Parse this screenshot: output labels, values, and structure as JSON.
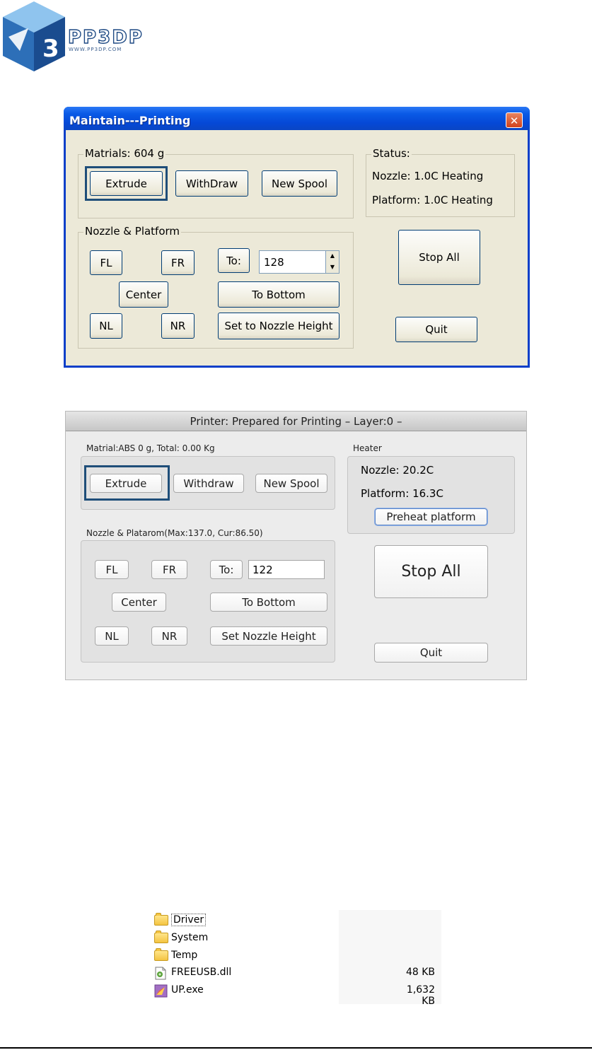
{
  "logo": {
    "text": "PP3DP",
    "url": "WWW.PP3DP.COM",
    "numeral": "3"
  },
  "xp_dialog": {
    "title": "Maintain---Printing",
    "close_symbol": "✕",
    "materials_label": "Matrials: 604 g",
    "extrude_label": "Extrude",
    "withdraw_label": "WithDraw",
    "new_spool_label": "New Spool",
    "status_label": "Status:",
    "nozzle_status": "Nozzle: 1.0C Heating",
    "platform_status": "Platform: 1.0C Heating",
    "nozzle_platform_label": "Nozzle & Platform",
    "fl_label": "FL",
    "fr_label": "FR",
    "to_label": "To:",
    "to_value": "128",
    "spin_up": "▲",
    "spin_down": "▼",
    "center_label": "Center",
    "to_bottom_label": "To Bottom",
    "nl_label": "NL",
    "nr_label": "NR",
    "set_nozzle_label": "Set to Nozzle Height",
    "stop_all_label": "Stop All",
    "quit_label": "Quit"
  },
  "mac_dialog": {
    "title": "Printer: Prepared for Printing – Layer:0 –",
    "material_label": "Matrial:ABS 0 g,  Total: 0.00 Kg",
    "extrude_label": "Extrude",
    "withdraw_label": "Withdraw",
    "new_spool_label": "New Spool",
    "heater_label": "Heater",
    "nozzle_temp": "Nozzle: 20.2C",
    "platform_temp": "Platform: 16.3C",
    "preheat_label": "Preheat platform",
    "nozzle_platform_label": "Nozzle & Platarom(Max:137.0, Cur:86.50)",
    "fl_label": "FL",
    "fr_label": "FR",
    "to_label": "To:",
    "to_value": "122",
    "center_label": "Center",
    "to_bottom_label": "To Bottom",
    "nl_label": "NL",
    "nr_label": "NR",
    "set_nozzle_label": "Set Nozzle  Height",
    "stop_all_label": "Stop All",
    "quit_label": "Quit"
  },
  "explorer": {
    "files": [
      {
        "name": "Driver",
        "size": "",
        "icon": "folder-icon"
      },
      {
        "name": "System",
        "size": "",
        "icon": "folder-icon"
      },
      {
        "name": "Temp",
        "size": "",
        "icon": "folder-icon"
      },
      {
        "name": "FREEUSB.dll",
        "size": "48 KB",
        "icon": "dll-file-icon"
      },
      {
        "name": "UP.exe",
        "size": "1,632 KB",
        "icon": "exe-file-icon"
      }
    ]
  }
}
